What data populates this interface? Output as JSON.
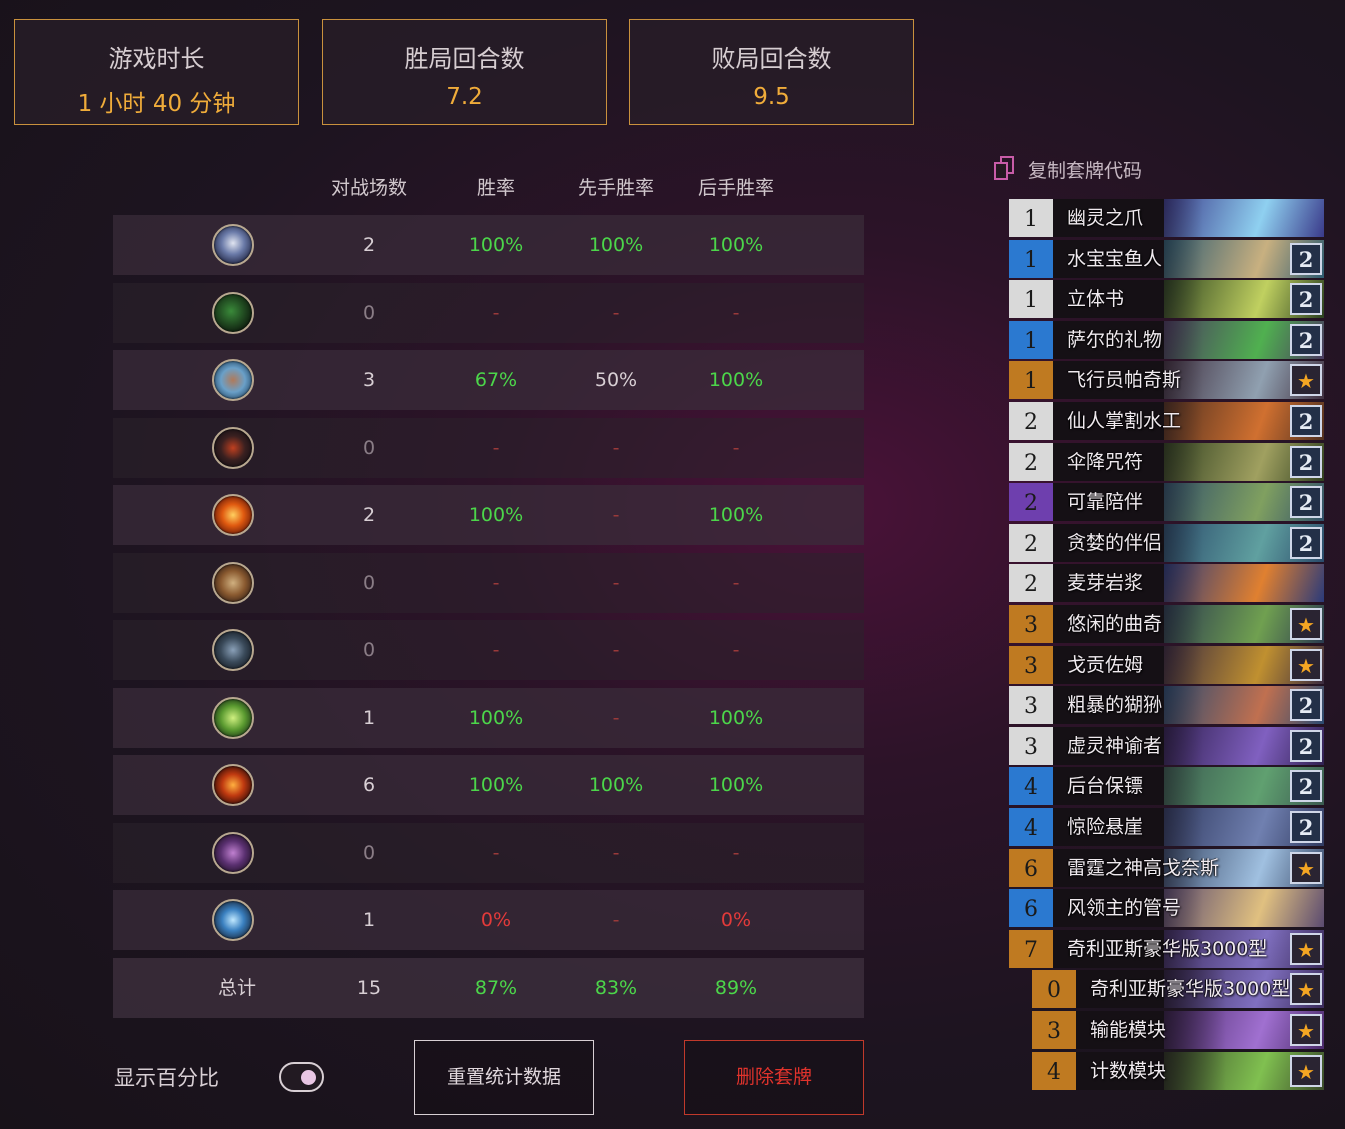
{
  "stats": [
    {
      "label": "游戏时长",
      "value": "1 小时 40 分钟"
    },
    {
      "label": "胜局回合数",
      "value": "7.2"
    },
    {
      "label": "败局回合数",
      "value": "9.5"
    }
  ],
  "table": {
    "headers": [
      "对战场数",
      "胜率",
      "先手胜率",
      "后手胜率"
    ],
    "rows": [
      {
        "icon": "class-icon-mage-crest",
        "games": "2",
        "win": "100%",
        "first": "100%",
        "second": "100%"
      },
      {
        "icon": "class-icon-druid-claw",
        "games": "0",
        "win": "-",
        "first": "-",
        "second": "-"
      },
      {
        "icon": "class-icon-shaman-fist",
        "games": "3",
        "win": "67%",
        "first": "50%",
        "second": "100%"
      },
      {
        "icon": "class-icon-demonhunter-blade",
        "games": "0",
        "win": "-",
        "first": "-",
        "second": "-"
      },
      {
        "icon": "class-icon-fire-sword",
        "games": "2",
        "win": "100%",
        "first": "-",
        "second": "100%"
      },
      {
        "icon": "class-icon-paladin-hammer",
        "games": "0",
        "win": "-",
        "first": "-",
        "second": "-"
      },
      {
        "icon": "class-icon-rogue-gear",
        "games": "0",
        "win": "-",
        "first": "-",
        "second": "-"
      },
      {
        "icon": "class-icon-hunter-arrow",
        "games": "1",
        "win": "100%",
        "first": "-",
        "second": "100%"
      },
      {
        "icon": "class-icon-warlock-skull",
        "games": "6",
        "win": "100%",
        "first": "100%",
        "second": "100%"
      },
      {
        "icon": "class-icon-priest-hand",
        "games": "0",
        "win": "-",
        "first": "-",
        "second": "-"
      },
      {
        "icon": "class-icon-warrior-sword",
        "games": "1",
        "win": "0%",
        "first": "-",
        "second": "0%"
      }
    ],
    "total": {
      "label": "总计",
      "games": "15",
      "win": "87%",
      "first": "83%",
      "second": "89%"
    }
  },
  "controls": {
    "show_percent_label": "显示百分比",
    "show_percent_on": true,
    "reset_label": "重置统计数据",
    "delete_label": "删除套牌"
  },
  "deck": {
    "copy_label": "复制套牌代码",
    "cards": [
      {
        "cost": "1",
        "rarity": "gray",
        "name": "幽灵之爪",
        "count": "",
        "art": [
          "#3a3a8a",
          "#8fd0f0"
        ]
      },
      {
        "cost": "1",
        "rarity": "blue",
        "name": "水宝宝鱼人",
        "count": "2",
        "art": [
          "#2c5a70",
          "#c8b080"
        ]
      },
      {
        "cost": "1",
        "rarity": "gray",
        "name": "立体书",
        "count": "2",
        "art": [
          "#2a4020",
          "#c0d060"
        ]
      },
      {
        "cost": "1",
        "rarity": "blue",
        "name": "萨尔的礼物",
        "count": "2",
        "art": [
          "#4a3a60",
          "#50b050"
        ]
      },
      {
        "cost": "1",
        "rarity": "orange",
        "name": "飞行员帕奇斯",
        "count": "★",
        "art": [
          "#403040",
          "#90a0b0"
        ]
      },
      {
        "cost": "2",
        "rarity": "gray",
        "name": "仙人掌割水工",
        "count": "2",
        "art": [
          "#503020",
          "#d07030"
        ]
      },
      {
        "cost": "2",
        "rarity": "gray",
        "name": "伞降咒符",
        "count": "2",
        "art": [
          "#304020",
          "#a0a060"
        ]
      },
      {
        "cost": "2",
        "rarity": "purple",
        "name": "可靠陪伴",
        "count": "2",
        "art": [
          "#30506a",
          "#80a060"
        ]
      },
      {
        "cost": "2",
        "rarity": "gray",
        "name": "贪婪的伴侣",
        "count": "2",
        "art": [
          "#2a4a6a",
          "#60a0a0"
        ]
      },
      {
        "cost": "2",
        "rarity": "gray",
        "name": "麦芽岩浆",
        "count": "",
        "art": [
          "#2a3a7a",
          "#e08030"
        ]
      },
      {
        "cost": "3",
        "rarity": "orange",
        "name": "悠闲的曲奇",
        "count": "★",
        "art": [
          "#2a3a50",
          "#70a050"
        ]
      },
      {
        "cost": "3",
        "rarity": "orange",
        "name": "戈贡佐姆",
        "count": "★",
        "art": [
          "#3a2a40",
          "#c09030"
        ]
      },
      {
        "cost": "3",
        "rarity": "gray",
        "name": "粗暴的猢狲",
        "count": "2",
        "art": [
          "#2a4a70",
          "#c07050"
        ]
      },
      {
        "cost": "3",
        "rarity": "gray",
        "name": "虚灵神谕者",
        "count": "2",
        "art": [
          "#302050",
          "#8060c0"
        ]
      },
      {
        "cost": "4",
        "rarity": "blue",
        "name": "后台保镖",
        "count": "2",
        "art": [
          "#3a5a50",
          "#60a070"
        ]
      },
      {
        "cost": "4",
        "rarity": "blue",
        "name": "惊险悬崖",
        "count": "2",
        "art": [
          "#303a60",
          "#7080b0"
        ]
      },
      {
        "cost": "6",
        "rarity": "orange",
        "name": "雷霆之神高戈奈斯",
        "count": "★",
        "art": [
          "#3a4a6a",
          "#a0c0e0"
        ]
      },
      {
        "cost": "6",
        "rarity": "blue",
        "name": "风领主的管号",
        "count": "",
        "art": [
          "#5a4a70",
          "#e0c080"
        ]
      },
      {
        "cost": "7",
        "rarity": "orange",
        "name": "奇利亚斯豪华版3000型",
        "count": "★",
        "art": [
          "#3a2a5a",
          "#8070c0"
        ]
      },
      {
        "cost": "0",
        "rarity": "orange",
        "name": "奇利亚斯豪华版3000型",
        "count": "★",
        "art": [
          "#3a2a5a",
          "#8070c0"
        ]
      },
      {
        "cost": "3",
        "rarity": "orange",
        "name": "输能模块",
        "count": "★",
        "art": [
          "#4a2a6a",
          "#a070d0"
        ]
      },
      {
        "cost": "4",
        "rarity": "orange",
        "name": "计数模块",
        "count": "★",
        "art": [
          "#3a4a2a",
          "#80c050"
        ]
      }
    ]
  }
}
